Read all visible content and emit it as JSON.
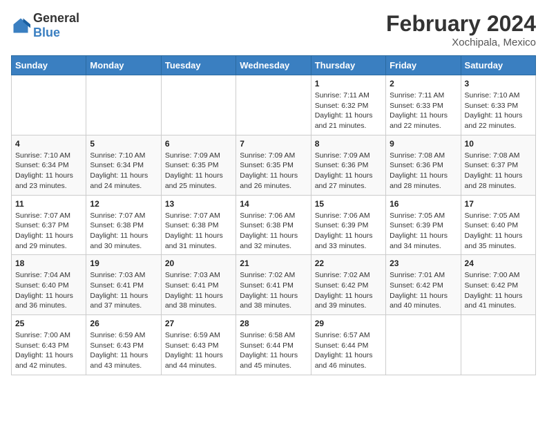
{
  "logo": {
    "text_general": "General",
    "text_blue": "Blue"
  },
  "title": {
    "month_year": "February 2024",
    "location": "Xochipala, Mexico"
  },
  "weekdays": [
    "Sunday",
    "Monday",
    "Tuesday",
    "Wednesday",
    "Thursday",
    "Friday",
    "Saturday"
  ],
  "weeks": [
    [
      {
        "day": "",
        "info": ""
      },
      {
        "day": "",
        "info": ""
      },
      {
        "day": "",
        "info": ""
      },
      {
        "day": "",
        "info": ""
      },
      {
        "day": "1",
        "info": "Sunrise: 7:11 AM\nSunset: 6:32 PM\nDaylight: 11 hours and 21 minutes."
      },
      {
        "day": "2",
        "info": "Sunrise: 7:11 AM\nSunset: 6:33 PM\nDaylight: 11 hours and 22 minutes."
      },
      {
        "day": "3",
        "info": "Sunrise: 7:10 AM\nSunset: 6:33 PM\nDaylight: 11 hours and 22 minutes."
      }
    ],
    [
      {
        "day": "4",
        "info": "Sunrise: 7:10 AM\nSunset: 6:34 PM\nDaylight: 11 hours and 23 minutes."
      },
      {
        "day": "5",
        "info": "Sunrise: 7:10 AM\nSunset: 6:34 PM\nDaylight: 11 hours and 24 minutes."
      },
      {
        "day": "6",
        "info": "Sunrise: 7:09 AM\nSunset: 6:35 PM\nDaylight: 11 hours and 25 minutes."
      },
      {
        "day": "7",
        "info": "Sunrise: 7:09 AM\nSunset: 6:35 PM\nDaylight: 11 hours and 26 minutes."
      },
      {
        "day": "8",
        "info": "Sunrise: 7:09 AM\nSunset: 6:36 PM\nDaylight: 11 hours and 27 minutes."
      },
      {
        "day": "9",
        "info": "Sunrise: 7:08 AM\nSunset: 6:36 PM\nDaylight: 11 hours and 28 minutes."
      },
      {
        "day": "10",
        "info": "Sunrise: 7:08 AM\nSunset: 6:37 PM\nDaylight: 11 hours and 28 minutes."
      }
    ],
    [
      {
        "day": "11",
        "info": "Sunrise: 7:07 AM\nSunset: 6:37 PM\nDaylight: 11 hours and 29 minutes."
      },
      {
        "day": "12",
        "info": "Sunrise: 7:07 AM\nSunset: 6:38 PM\nDaylight: 11 hours and 30 minutes."
      },
      {
        "day": "13",
        "info": "Sunrise: 7:07 AM\nSunset: 6:38 PM\nDaylight: 11 hours and 31 minutes."
      },
      {
        "day": "14",
        "info": "Sunrise: 7:06 AM\nSunset: 6:38 PM\nDaylight: 11 hours and 32 minutes."
      },
      {
        "day": "15",
        "info": "Sunrise: 7:06 AM\nSunset: 6:39 PM\nDaylight: 11 hours and 33 minutes."
      },
      {
        "day": "16",
        "info": "Sunrise: 7:05 AM\nSunset: 6:39 PM\nDaylight: 11 hours and 34 minutes."
      },
      {
        "day": "17",
        "info": "Sunrise: 7:05 AM\nSunset: 6:40 PM\nDaylight: 11 hours and 35 minutes."
      }
    ],
    [
      {
        "day": "18",
        "info": "Sunrise: 7:04 AM\nSunset: 6:40 PM\nDaylight: 11 hours and 36 minutes."
      },
      {
        "day": "19",
        "info": "Sunrise: 7:03 AM\nSunset: 6:41 PM\nDaylight: 11 hours and 37 minutes."
      },
      {
        "day": "20",
        "info": "Sunrise: 7:03 AM\nSunset: 6:41 PM\nDaylight: 11 hours and 38 minutes."
      },
      {
        "day": "21",
        "info": "Sunrise: 7:02 AM\nSunset: 6:41 PM\nDaylight: 11 hours and 38 minutes."
      },
      {
        "day": "22",
        "info": "Sunrise: 7:02 AM\nSunset: 6:42 PM\nDaylight: 11 hours and 39 minutes."
      },
      {
        "day": "23",
        "info": "Sunrise: 7:01 AM\nSunset: 6:42 PM\nDaylight: 11 hours and 40 minutes."
      },
      {
        "day": "24",
        "info": "Sunrise: 7:00 AM\nSunset: 6:42 PM\nDaylight: 11 hours and 41 minutes."
      }
    ],
    [
      {
        "day": "25",
        "info": "Sunrise: 7:00 AM\nSunset: 6:43 PM\nDaylight: 11 hours and 42 minutes."
      },
      {
        "day": "26",
        "info": "Sunrise: 6:59 AM\nSunset: 6:43 PM\nDaylight: 11 hours and 43 minutes."
      },
      {
        "day": "27",
        "info": "Sunrise: 6:59 AM\nSunset: 6:43 PM\nDaylight: 11 hours and 44 minutes."
      },
      {
        "day": "28",
        "info": "Sunrise: 6:58 AM\nSunset: 6:44 PM\nDaylight: 11 hours and 45 minutes."
      },
      {
        "day": "29",
        "info": "Sunrise: 6:57 AM\nSunset: 6:44 PM\nDaylight: 11 hours and 46 minutes."
      },
      {
        "day": "",
        "info": ""
      },
      {
        "day": "",
        "info": ""
      }
    ]
  ]
}
